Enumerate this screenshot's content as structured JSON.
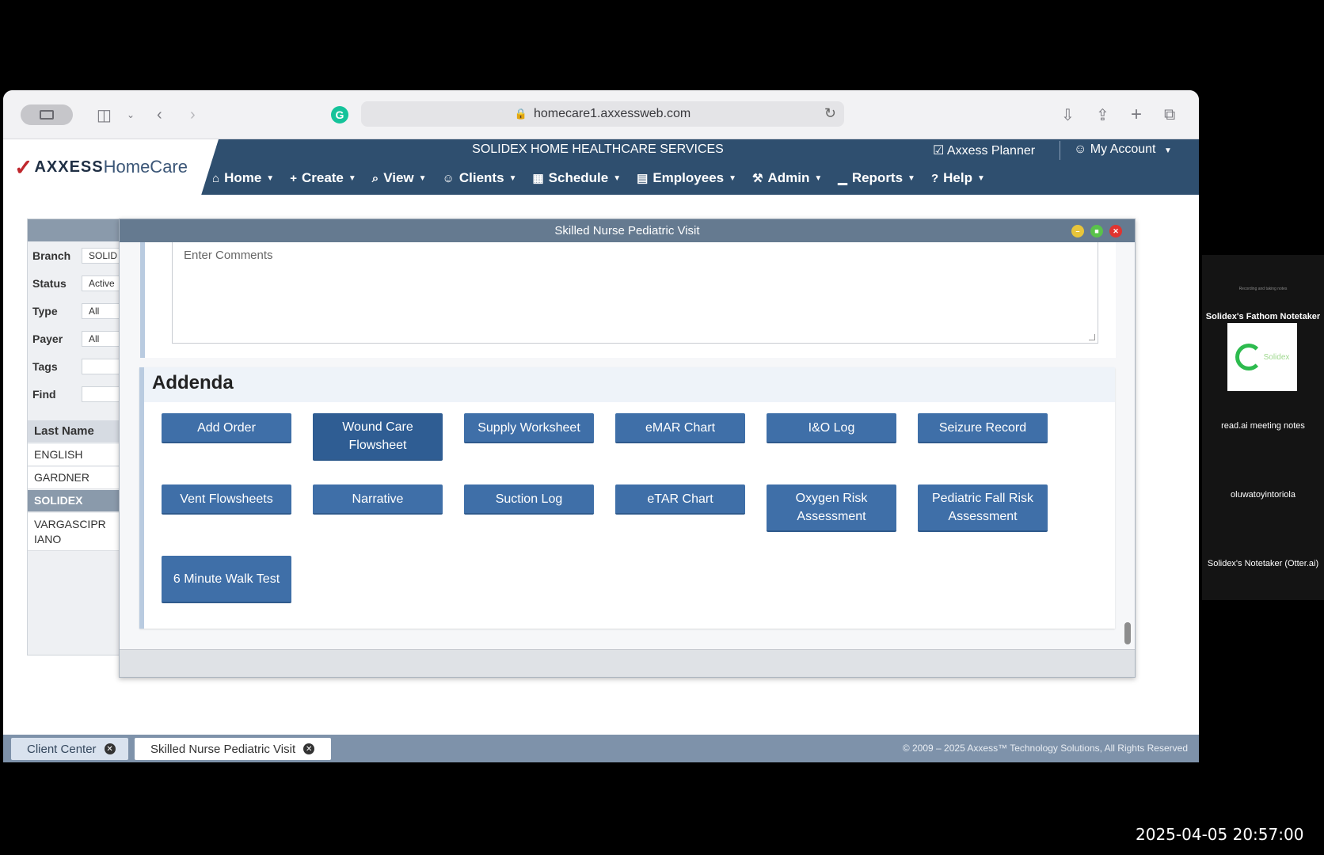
{
  "browser": {
    "url": "homecare1.axxessweb.com"
  },
  "app": {
    "brand_ax": "AXXESS",
    "brand_hc": "HomeCare",
    "agency": "SOLIDEX HOME HEALTHCARE SERVICES",
    "planner": "Axxess Planner",
    "account": "My Account",
    "nav": [
      {
        "icon": "⌂",
        "label": "Home"
      },
      {
        "icon": "+",
        "label": "Create"
      },
      {
        "icon": "⌕",
        "label": "View"
      },
      {
        "icon": "☺",
        "label": "Clients"
      },
      {
        "icon": "▦",
        "label": "Schedule"
      },
      {
        "icon": "▤",
        "label": "Employees"
      },
      {
        "icon": "⚒",
        "label": "Admin"
      },
      {
        "icon": "▁",
        "label": "Reports"
      },
      {
        "icon": "?",
        "label": "Help"
      }
    ]
  },
  "left_panel": {
    "filters": [
      {
        "label": "Branch",
        "value": "SOLID"
      },
      {
        "label": "Status",
        "value": "Active"
      },
      {
        "label": "Type",
        "value": "All"
      },
      {
        "label": "Payer",
        "value": "All"
      },
      {
        "label": "Tags",
        "value": ""
      },
      {
        "label": "Find",
        "value": ""
      }
    ],
    "column_header": "Last Name",
    "rows": [
      "ENGLISH",
      "GARDNER",
      "SOLIDEX",
      "VARGASCIPR IANO"
    ],
    "selected_row": "SOLIDEX"
  },
  "modal": {
    "title": "Skilled Nurse Pediatric Visit",
    "comments_placeholder": "Enter Comments",
    "addenda_title": "Addenda",
    "buttons": [
      "Add Order",
      "Wound Care Flowsheet",
      "Supply Worksheet",
      "eMAR Chart",
      "I&O Log",
      "Seizure Record",
      "Vent Flowsheets",
      "Narrative",
      "Suction Log",
      "eTAR Chart",
      "Oxygen Risk Assessment",
      "Pediatric Fall Risk Assessment",
      "6 Minute Walk Test"
    ]
  },
  "bottom_tabs": [
    "Client Center",
    "Skilled Nurse Pediatric Visit"
  ],
  "copyright": "© 2009 – 2025 Axxess™ Technology Solutions, All Rights Reserved",
  "meeting": {
    "top_caption": "Recording and taking notes",
    "participants": [
      "Solidex's Fathom Notetaker",
      "read.ai meeting notes",
      "oluwatoyintoriola",
      "Solidex's Notetaker (Otter.ai)"
    ],
    "logo_text": "Solidex"
  },
  "timestamp": "2025-04-05 20:57:00",
  "colors": {
    "header": "#2f4f6f",
    "button": "#3f6fa8",
    "modal_title": "#657a90"
  }
}
